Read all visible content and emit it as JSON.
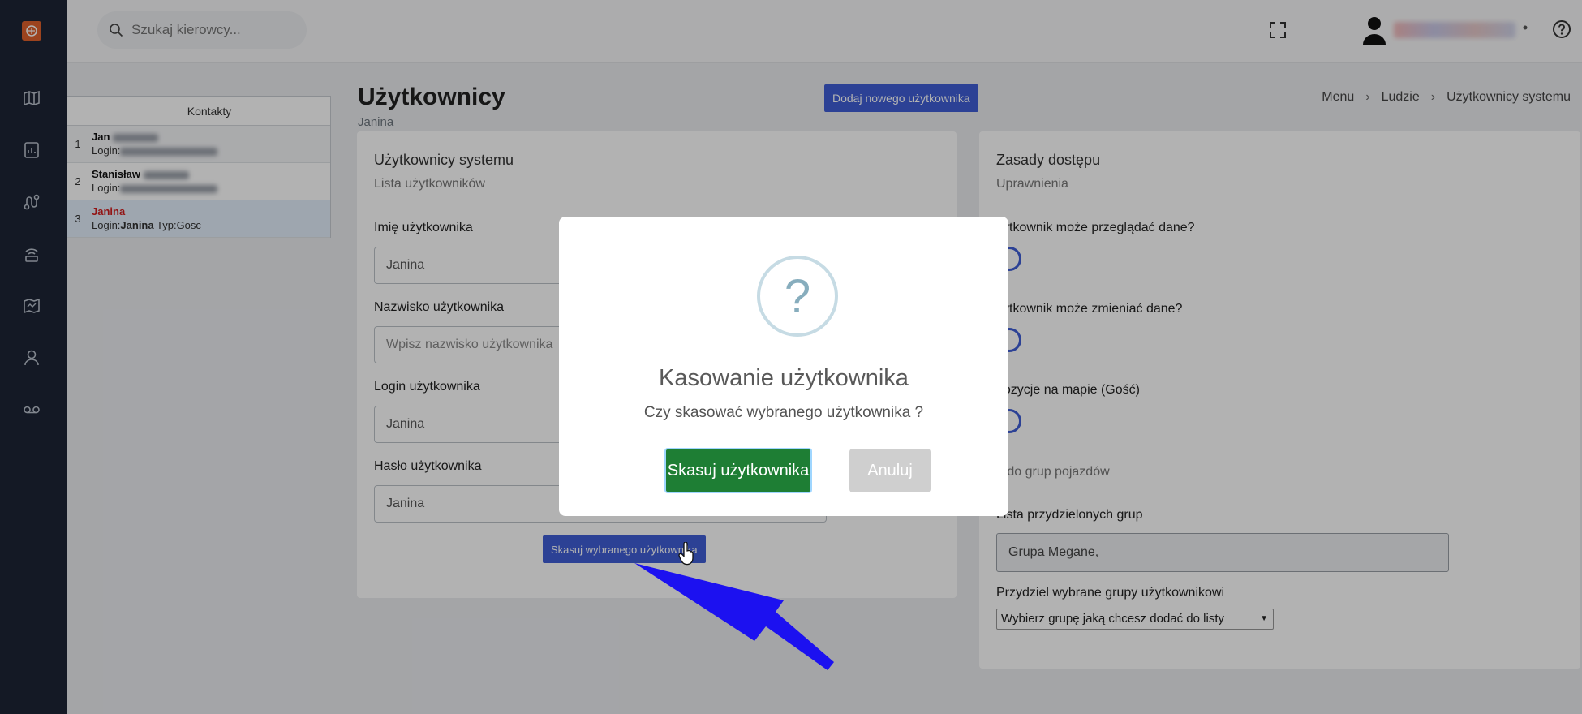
{
  "sidebar": {
    "icons": [
      "map-icon",
      "report-chart-icon",
      "route-icon",
      "antenna-icon",
      "area-map-icon",
      "user-icon",
      "voicemail-icon"
    ]
  },
  "header": {
    "search_placeholder": "Szukaj kierowcy..."
  },
  "contacts": {
    "title": "Kontakty",
    "login_prefix": "Login:",
    "rows": [
      {
        "index": "1",
        "name": "Jan"
      },
      {
        "index": "2",
        "name": "Stanisław"
      },
      {
        "index": "3",
        "name": "Janina",
        "login": "Janina",
        "type": "Typ:Gosc"
      }
    ]
  },
  "page": {
    "title": "Użytkownicy",
    "subtitle": "Janina",
    "add_button": "Dodaj nowego użytkownika",
    "breadcrumb": [
      "Menu",
      "Ludzie",
      "Użytkownicy systemu"
    ]
  },
  "users_form": {
    "title": "Użytkownicy systemu",
    "subtitle": "Lista użytkowników",
    "first_name_label": "Imię użytkownika",
    "first_name_value": "Janina",
    "last_name_label": "Nazwisko użytkownika",
    "last_name_placeholder": "Wpisz nazwisko użytkownika",
    "login_label": "Login użytkownika",
    "login_value": "Janina",
    "password_label": "Hasło użytkownika",
    "password_value": "Janina",
    "delete_button": "Skasuj wybranego użytkownika"
  },
  "access": {
    "title": "Zasady dostępu",
    "subtitle": "Uprawnienia",
    "q1": "żytkownik może przeglądać dane?",
    "q2": "żytkownik może zmieniać dane?",
    "q3": "pozycje na mapie (Gość)",
    "section": "o do grup pojazdów",
    "groups_label": "Lista przydzielonych grup",
    "groups_value": "Grupa Megane,",
    "assign_label": "Przydziel wybrane grupy użytkownikowi",
    "select_value": "Wybierz grupę jaką chcesz dodać do listy"
  },
  "modal": {
    "icon": "?",
    "title": "Kasowanie użytkownika",
    "text": "Czy skasować wybranego użytkownika ?",
    "confirm": "Skasuj użytkownika",
    "cancel": "Anuluj"
  },
  "colors": {
    "nav_bg": "#1d2535",
    "primary": "#3f5ed6",
    "confirm": "#1e7e34",
    "cancel": "#cfcfcf",
    "annotation_arrow": "#1c11f0"
  }
}
